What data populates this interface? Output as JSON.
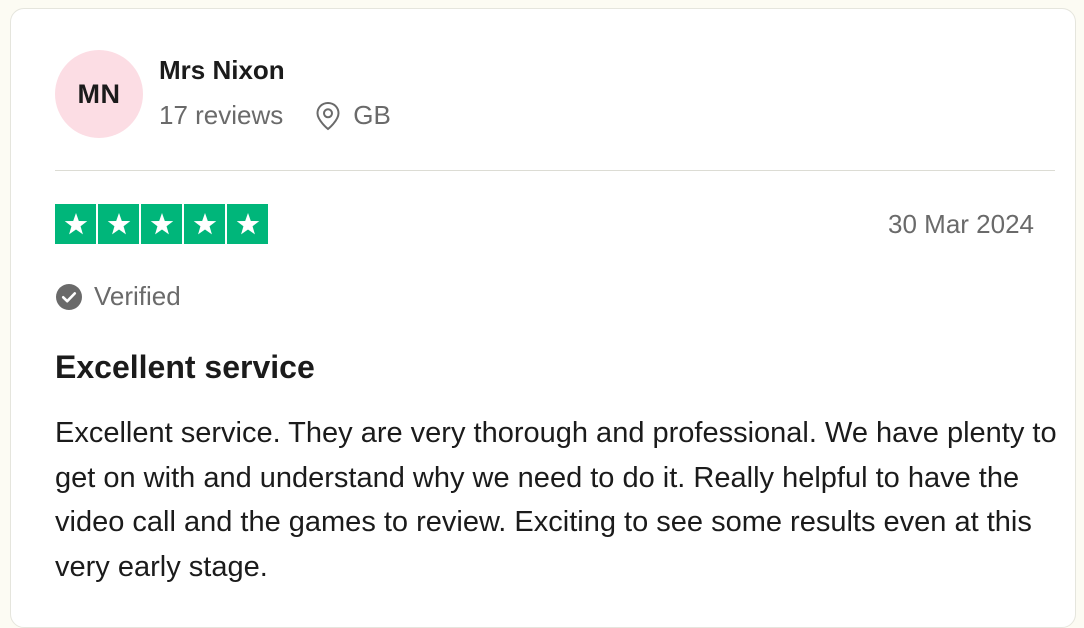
{
  "reviewer": {
    "initials": "MN",
    "name": "Mrs Nixon",
    "reviews_count": "17 reviews",
    "country": "GB",
    "location_icon": "location-pin-icon"
  },
  "review": {
    "rating": 5,
    "max_rating": 5,
    "date": "30 Mar 2024",
    "verified_label": "Verified",
    "title": "Excellent service",
    "body": "Excellent service. They are very thorough and professional. We have plenty to get on with and understand why we need to do it. Really helpful to have the video call and the games to review. Exciting to see some results even at this very early stage."
  },
  "colors": {
    "star_green": "#00b67a",
    "avatar_bg": "#fcdde4",
    "muted_text": "#6a6a6a",
    "text": "#1b1b1b",
    "verified_icon": "#6a6a6a"
  }
}
